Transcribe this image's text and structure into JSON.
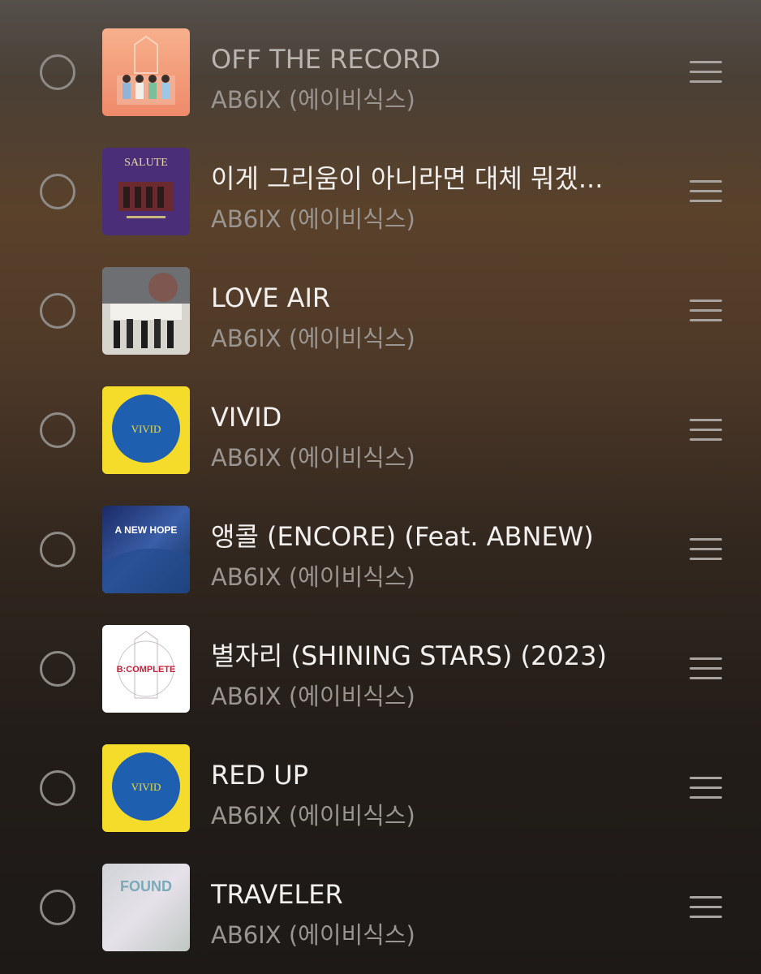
{
  "playlist": {
    "tracks": [
      {
        "title": "OFF THE RECORD",
        "artist": "AB6IX (에이비식스)",
        "cover": "off-the-record-cover"
      },
      {
        "title": "이게 그리움이 아니라면 대체 뭐겠...",
        "artist": "AB6IX (에이비식스)",
        "cover": "salute-cover",
        "cover_text": "SALUTE"
      },
      {
        "title": "LOVE AIR",
        "artist": "AB6IX (에이비식스)",
        "cover": "love-air-cover"
      },
      {
        "title": "VIVID",
        "artist": "AB6IX (에이비식스)",
        "cover": "vivid-cover",
        "cover_text": "VIVID"
      },
      {
        "title": "앵콜 (ENCORE) (Feat. ABNEW)",
        "artist": "AB6IX (에이비식스)",
        "cover": "a-new-hope-cover",
        "cover_text": "A NEW HOPE"
      },
      {
        "title": "별자리 (SHINING STARS) (2023)",
        "artist": "AB6IX (에이비식스)",
        "cover": "b-complete-cover",
        "cover_text": "B:COMPLETE"
      },
      {
        "title": "RED UP",
        "artist": "AB6IX (에이비식스)",
        "cover": "vivid-cover",
        "cover_text": "VIVID"
      },
      {
        "title": "TRAVELER",
        "artist": "AB6IX (에이비식스)",
        "cover": "found-cover",
        "cover_text": "FOUND"
      }
    ]
  },
  "colors": {
    "title": "#f2f0ee",
    "artist": "#9a9591",
    "handle": "#a8a39f",
    "vivid_yellow": "#f5dc2a",
    "vivid_blue": "#1f5fb0"
  },
  "icons": {
    "select": "empty-circle",
    "reorder": "drag-handle-icon"
  }
}
